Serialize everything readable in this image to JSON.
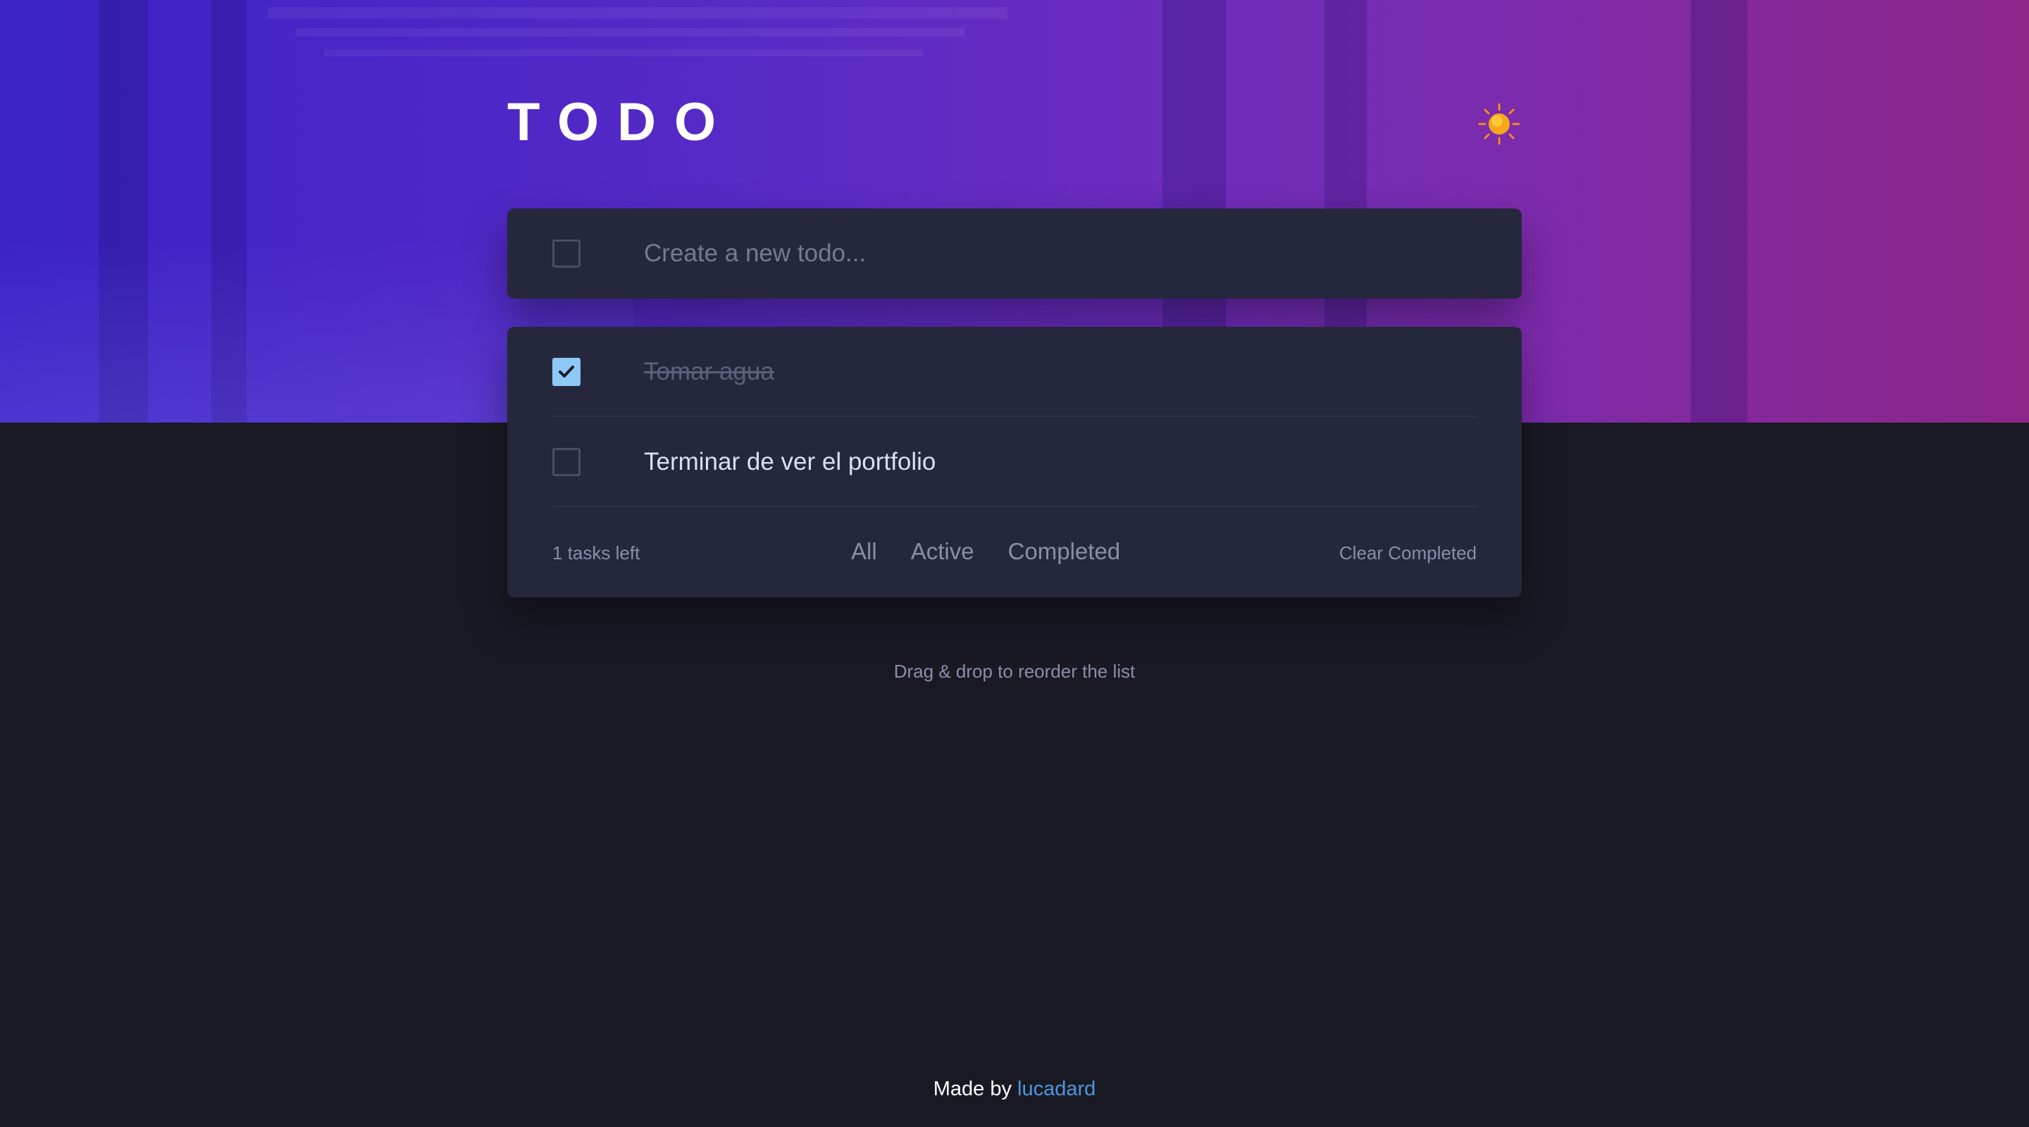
{
  "header": {
    "title": "TODO",
    "theme_toggle_icon": "sun-icon"
  },
  "new_todo": {
    "placeholder": "Create a new todo..."
  },
  "todos": [
    {
      "text": "Tomar agua",
      "completed": true
    },
    {
      "text": "Terminar de ver el portfolio",
      "completed": false
    }
  ],
  "footer": {
    "count_label": "1 tasks left",
    "filters": [
      "All",
      "Active",
      "Completed"
    ],
    "clear_label": "Clear Completed"
  },
  "hint": "Drag & drop to reorder the list",
  "credit": {
    "prefix": "Made by",
    "author": "lucadard"
  },
  "colors": {
    "check_fill": "#8ec8f5",
    "card_bg": "#25273c",
    "page_bg": "#181922",
    "link": "#4d97e0"
  }
}
